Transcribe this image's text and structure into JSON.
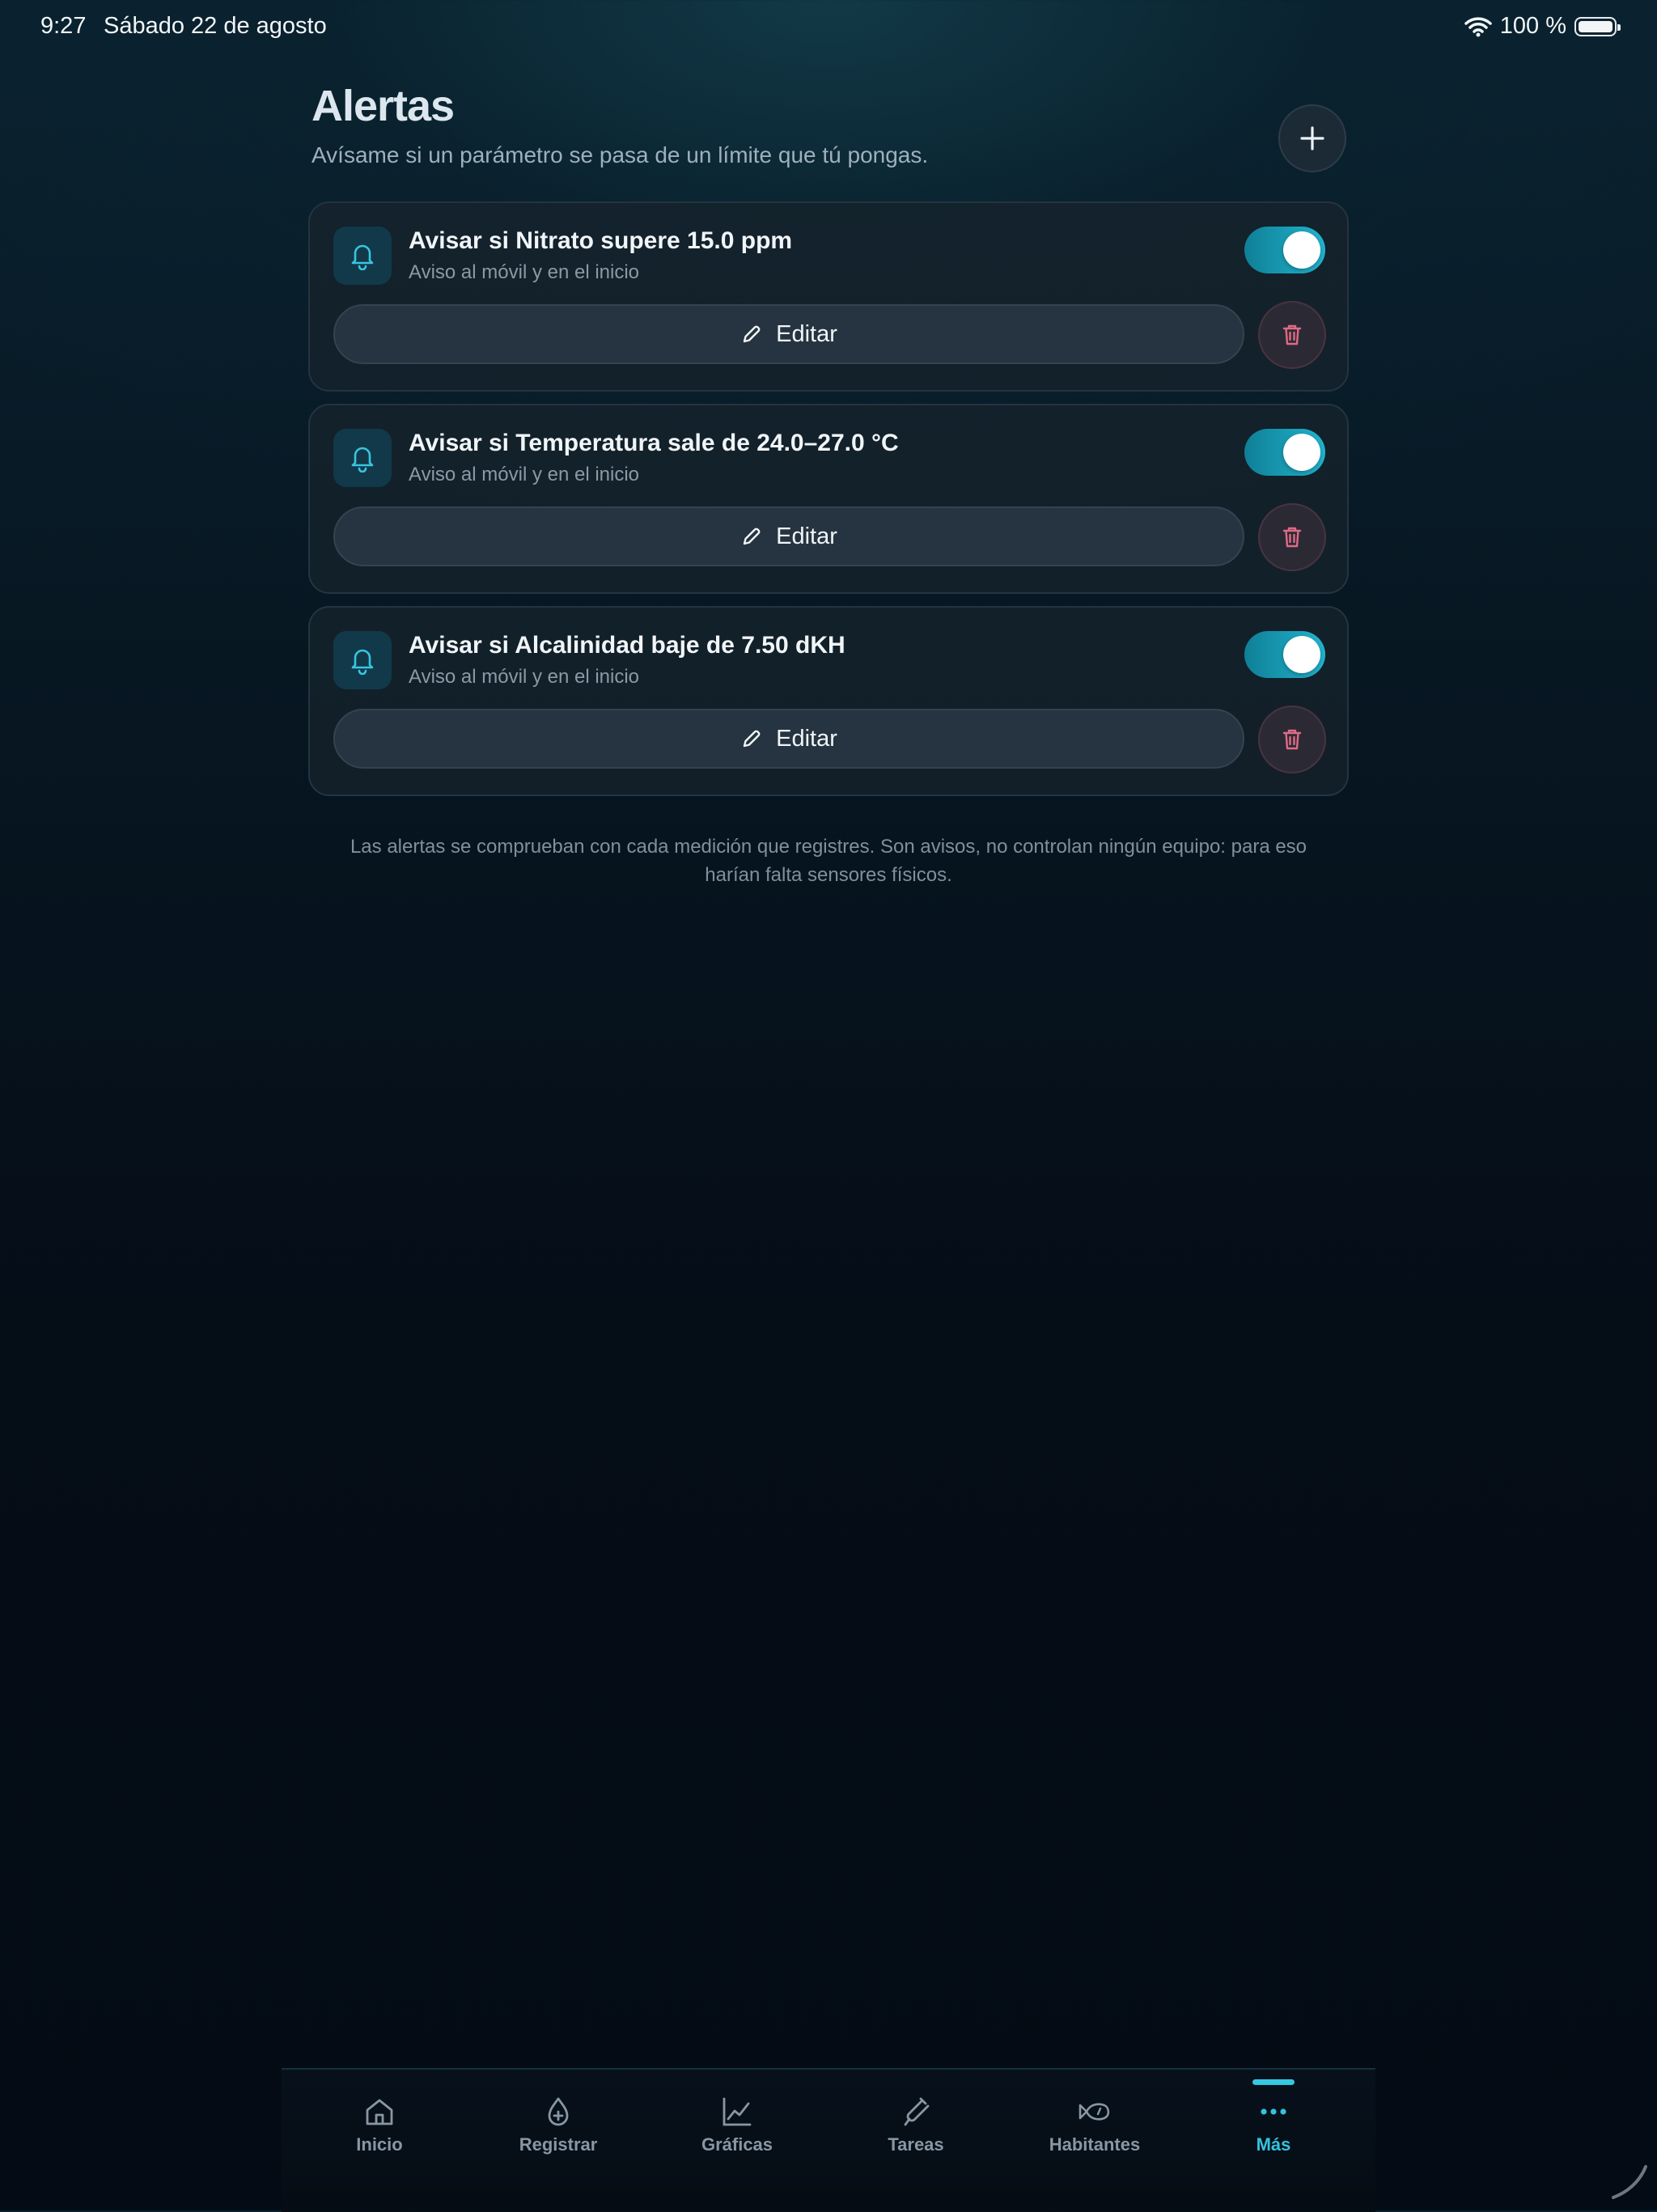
{
  "status_bar": {
    "time": "9:27",
    "date": "Sábado 22 de agosto",
    "battery": "100 %"
  },
  "header": {
    "title": "Alertas",
    "subtitle": "Avísame si un parámetro se pasa de un límite que tú pongas."
  },
  "alerts": [
    {
      "title": "Avisar si Nitrato supere 15.0 ppm",
      "subtitle": "Aviso al móvil y en el inicio",
      "enabled": true,
      "edit_label": "Editar"
    },
    {
      "title": "Avisar si Temperatura sale de 24.0–27.0 °C",
      "subtitle": "Aviso al móvil y en el inicio",
      "enabled": true,
      "edit_label": "Editar"
    },
    {
      "title": "Avisar si Alcalinidad baje de 7.50 dKH",
      "subtitle": "Aviso al móvil y en el inicio",
      "enabled": true,
      "edit_label": "Editar"
    }
  ],
  "footnote": "Las alertas se comprueban con cada medición que registres. Son avisos, no controlan ningún equipo: para eso harían falta sensores físicos.",
  "tabs": [
    {
      "label": "Inicio",
      "icon": "home-icon",
      "active": false
    },
    {
      "label": "Registrar",
      "icon": "drop-plus-icon",
      "active": false
    },
    {
      "label": "Gráficas",
      "icon": "chart-line-icon",
      "active": false
    },
    {
      "label": "Tareas",
      "icon": "test-tube-icon",
      "active": false
    },
    {
      "label": "Habitantes",
      "icon": "fish-icon",
      "active": false
    },
    {
      "label": "Más",
      "icon": "more-dots-icon",
      "active": true
    }
  ],
  "colors": {
    "accent": "#33c3df",
    "toggle_on": "#1aa3bf",
    "danger": "#e06a86"
  }
}
